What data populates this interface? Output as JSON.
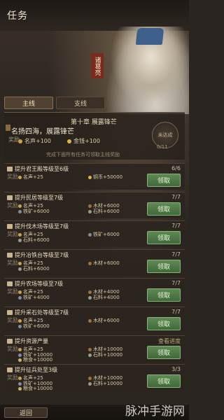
{
  "header": {
    "title": "任务"
  },
  "seal_text": "诸葛亮",
  "tabs": [
    {
      "label": "主线",
      "active": true
    },
    {
      "label": "支线",
      "active": false
    }
  ],
  "story": {
    "chapter": "第十章  展露锋芒",
    "name": "名扬四海，展露锋芒",
    "reward_label": "奖励",
    "rewards": [
      {
        "text": "名声+100",
        "icon": "fame-icon"
      },
      {
        "text": "金钱+100",
        "icon": "coin-icon"
      }
    ],
    "hint": "完成下面所有任务可领取主线奖励",
    "button_label": "未达成",
    "progress": "0/11"
  },
  "tasks": [
    {
      "name": "提升君王殿等级至6级",
      "progress": "6/6",
      "reward_label": "奖励",
      "rewards": [
        "名声+25",
        "铜币+50000"
      ],
      "claim": "领取"
    },
    {
      "name": "提升民居等级至7级",
      "progress": "7/7",
      "reward_label": "奖励",
      "rewards": [
        "名声+25",
        "木材+6000",
        "铁矿+6000",
        "石料+6000"
      ],
      "claim": "领取"
    },
    {
      "name": "提升伐木场等级至7级",
      "progress": "7/7",
      "reward_label": "奖励",
      "rewards": [
        "名声+25",
        "铁矿+6000",
        "石料+6000"
      ],
      "claim": "领取"
    },
    {
      "name": "提升冶铁台等级至7级",
      "progress": "7/7",
      "reward_label": "奖励",
      "rewards": [
        "名声+25",
        "木材+6000",
        "石料+6000"
      ],
      "claim": "领取"
    },
    {
      "name": "提升农场等级至7级",
      "progress": "7/7",
      "reward_label": "奖励",
      "rewards": [
        "名声+25",
        "木材+4000",
        "铁矿+4000",
        "石料+4000"
      ],
      "claim": "领取"
    },
    {
      "name": "提升采石处等级至7级",
      "progress": "7/7",
      "reward_label": "奖励",
      "rewards": [
        "名声+25",
        "木材+6000",
        "铁矿+6000"
      ],
      "claim": "领取"
    },
    {
      "name": "提升资源产量",
      "progress": "查看进度",
      "reward_label": "奖励",
      "rewards": [
        "名声+25",
        "木材+10000",
        "铁矿+10000",
        "石料+10000",
        "粮食+10000"
      ],
      "claim": "领取"
    },
    {
      "name": "提升征兵处至3级",
      "progress": "3/3",
      "reward_label": "奖励",
      "rewards": [
        "名声+25",
        "木材+10000",
        "铁矿+10000",
        "石料+10000",
        "粮食+10000"
      ],
      "claim": "领取"
    }
  ],
  "footer": {
    "back_label": "返回"
  },
  "watermark": "脉冲手游网",
  "colors": {
    "claim_green": "#4e7a45",
    "fame": "#c9a24a",
    "coin": "#d9b44a",
    "wood": "#a07040",
    "iron": "#7f8c99",
    "stone": "#9a9a8a",
    "food": "#c8b36a"
  }
}
